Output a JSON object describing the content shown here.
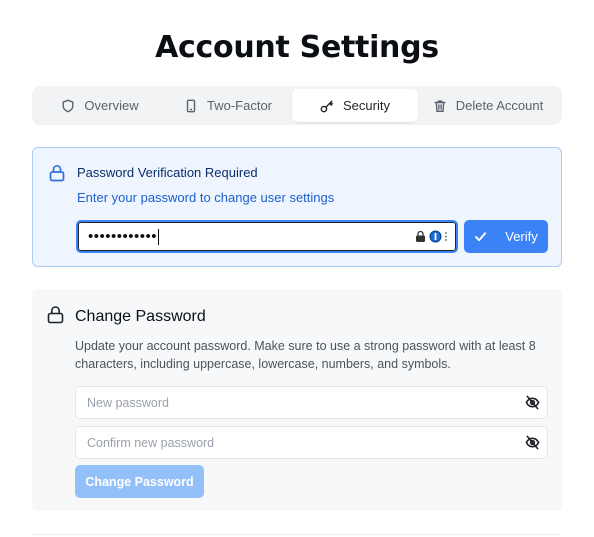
{
  "page": {
    "title": "Account Settings"
  },
  "tabs": [
    {
      "label": "Overview",
      "icon": "shield-icon",
      "active": false
    },
    {
      "label": "Two-Factor",
      "icon": "smartphone-icon",
      "active": false
    },
    {
      "label": "Security",
      "icon": "key-icon",
      "active": true
    },
    {
      "label": "Delete Account",
      "icon": "trash-icon",
      "active": false
    }
  ],
  "verification": {
    "icon": "lock-icon",
    "title": "Password Verification Required",
    "description": "Enter your password to change user settings",
    "password_value": "••••••••••••",
    "button_label": "Verify",
    "button_icon": "check-icon",
    "colors": {
      "background": "#eef5ff",
      "border": "#a9cdf6",
      "accent": "#3b82f6"
    }
  },
  "change_password": {
    "icon": "lock-icon",
    "title": "Change Password",
    "description": "Update your account password. Make sure to use a strong password with at least 8 characters, including uppercase, lowercase, numbers, and symbols.",
    "new_password_placeholder": "New password",
    "confirm_password_placeholder": "Confirm new password",
    "button_label": "Change Password",
    "button_disabled": true,
    "colors": {
      "button": "#93c0f8"
    }
  }
}
